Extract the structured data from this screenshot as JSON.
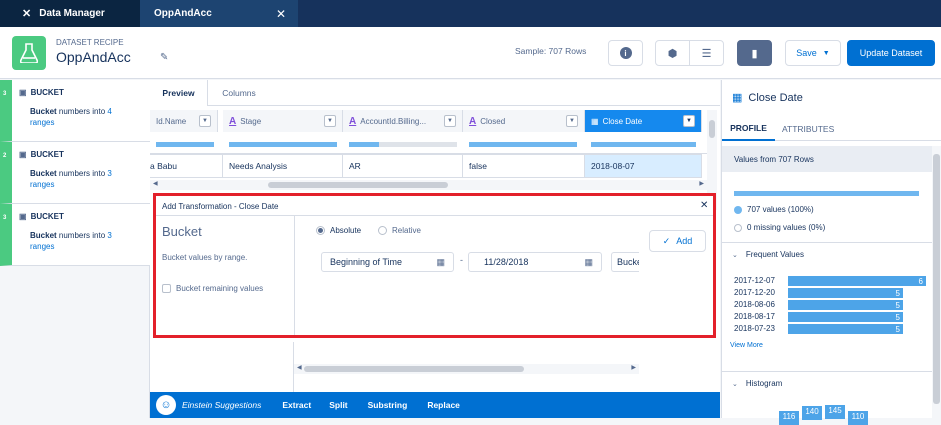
{
  "tabs": {
    "app": "Data Manager",
    "recipe": "OppAndAcc"
  },
  "header": {
    "eyebrow": "DATASET RECIPE",
    "title": "OppAndAcc",
    "sample": "Sample: 707 Rows",
    "save": "Save",
    "update": "Update Dataset"
  },
  "steps": [
    {
      "num": "3",
      "title": "BUCKET",
      "pre": "Bucket",
      "mid": " numbers into ",
      "count": "4",
      "post": "ranges"
    },
    {
      "num": "2",
      "title": "BUCKET",
      "pre": "Bucket",
      "mid": " numbers into ",
      "count": "3",
      "post": "ranges"
    },
    {
      "num": "3",
      "title": "BUCKET",
      "pre": "Bucket",
      "mid": " numbers into ",
      "count": "3",
      "post": "ranges"
    }
  ],
  "view_tabs": {
    "preview": "Preview",
    "columns": "Columns"
  },
  "columns": [
    {
      "label": "Id.Name"
    },
    {
      "label": "Stage"
    },
    {
      "label": "AccountId.Billing..."
    },
    {
      "label": "Closed"
    },
    {
      "label": "Close Date"
    }
  ],
  "row": [
    "а Babu",
    "Needs Analysis",
    "AR",
    "false",
    "2018-08-07"
  ],
  "modal": {
    "title": "Add Transformation - Close Date",
    "heading": "Bucket",
    "subtitle": "Bucket values by range.",
    "checkbox": "Bucket remaining values",
    "radio_absolute": "Absolute",
    "radio_relative": "Relative",
    "start": "Beginning of Time",
    "end": "11/28/2018",
    "bucket_placeholder": "Bucke",
    "dash": "-",
    "add": "Add"
  },
  "bottom": {
    "einstein": "Einstein Suggestions",
    "actions": [
      "Extract",
      "Split",
      "Substring",
      "Replace"
    ]
  },
  "profile": {
    "column": "Close Date",
    "tabs": [
      "PROFILE",
      "ATTRIBUTES"
    ],
    "values_from": "Values from 707 Rows",
    "valid": "707 values (100%)",
    "missing": "0 missing values (0%)",
    "frequent_title": "Frequent Values",
    "frequent": [
      {
        "label": "2017-12-07",
        "count": 6
      },
      {
        "label": "2017-12-20",
        "count": 5
      },
      {
        "label": "2018-08-06",
        "count": 5
      },
      {
        "label": "2018-08-17",
        "count": 5
      },
      {
        "label": "2018-07-23",
        "count": 5
      }
    ],
    "view_more": "View More",
    "histogram_title": "Histogram",
    "histogram": [
      "116",
      "140",
      "145",
      "110"
    ]
  },
  "colors": {
    "navy": "#16325c",
    "blue": "#0070d2",
    "green": "#4bca81",
    "red": "#e3202a",
    "bar": "#4da4e8"
  }
}
